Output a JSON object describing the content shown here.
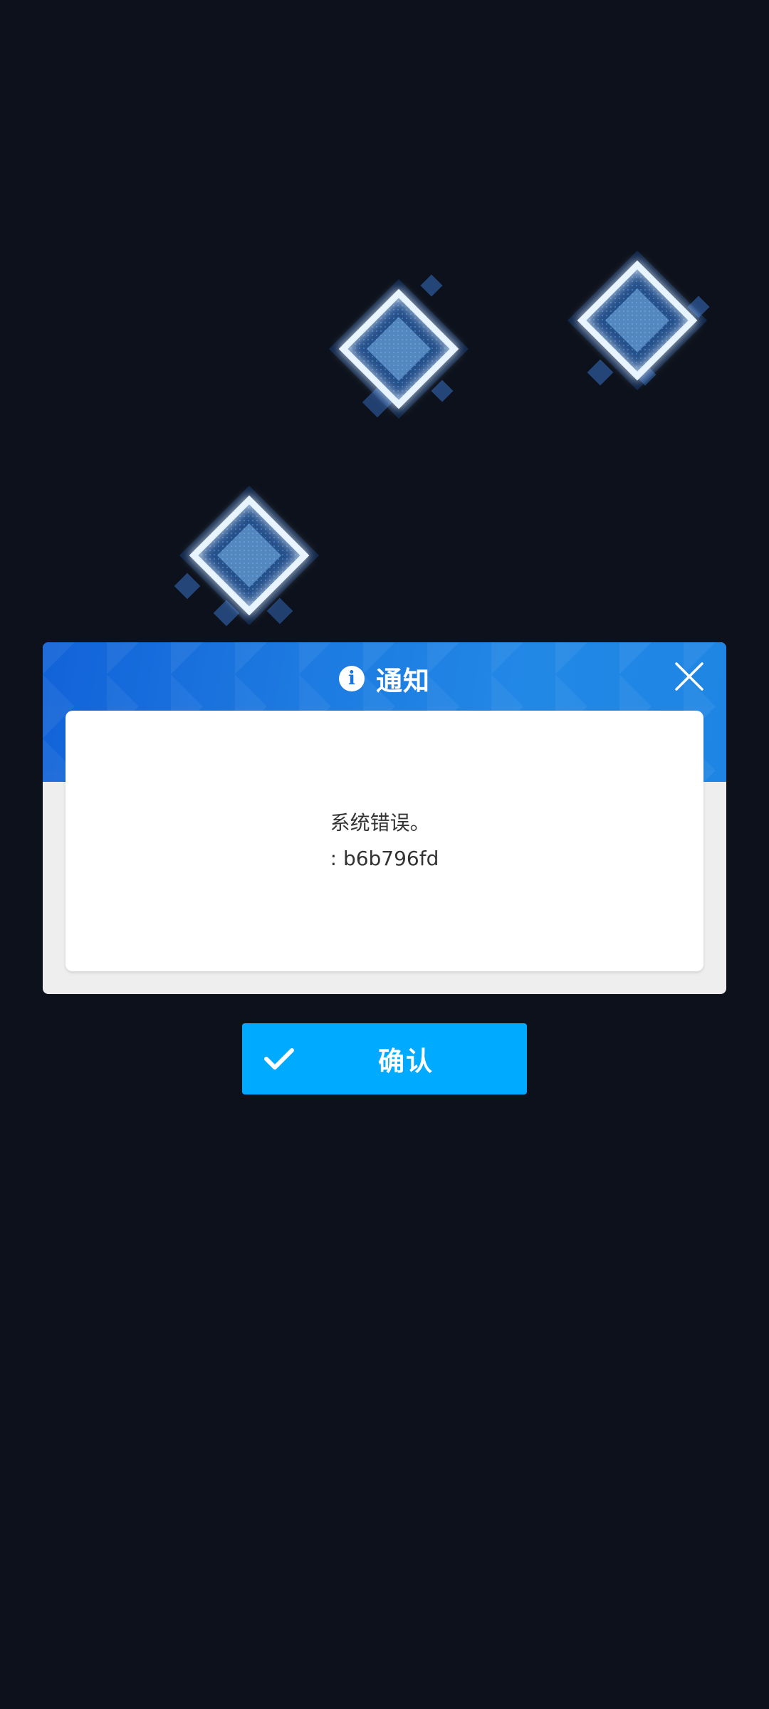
{
  "dialog": {
    "title": "通知",
    "title_icon": "info-icon",
    "close_icon": "close-icon",
    "message_line1": "系统错误。",
    "message_line2": ": b6b796fd"
  },
  "confirm_button": {
    "label": "确认",
    "icon": "check-icon"
  },
  "colors": {
    "background": "#0c111b",
    "header_blue": "#1c79e0",
    "button_blue": "#00aaff",
    "diamond_glow": "#4da3ff"
  }
}
